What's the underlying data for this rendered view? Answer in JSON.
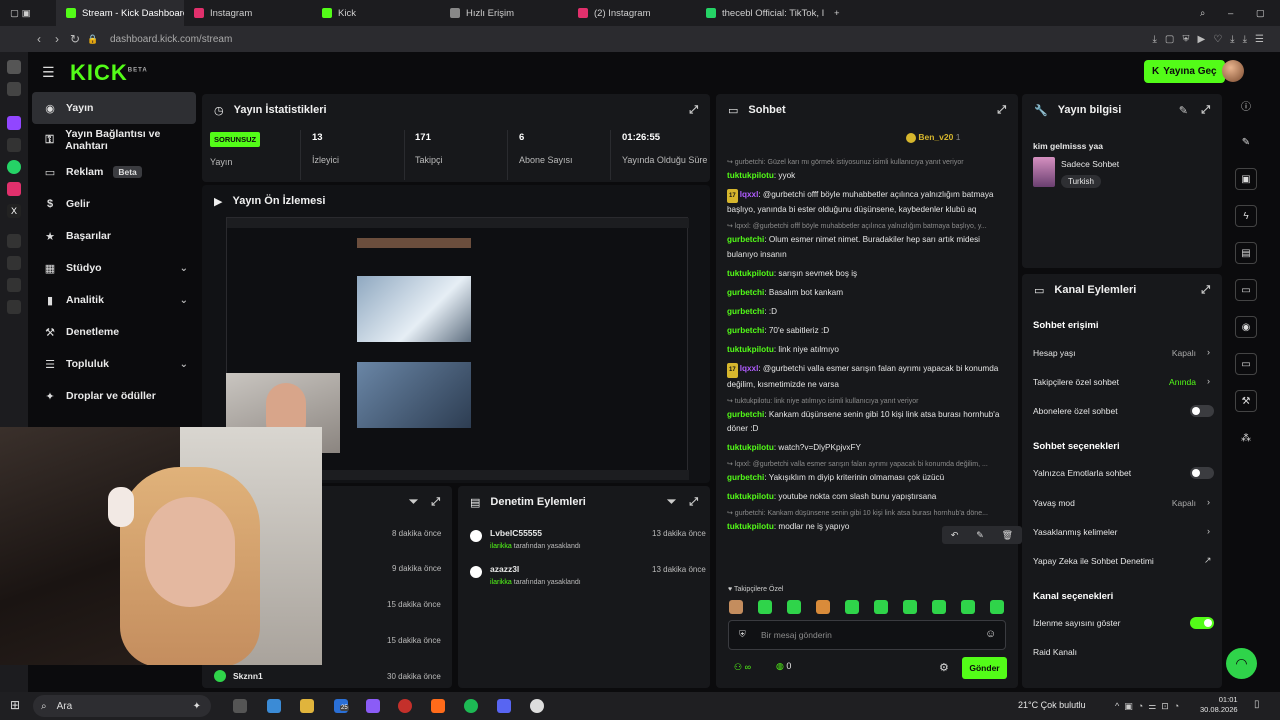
{
  "browser": {
    "tabs": [
      {
        "label": "Stream - Kick Dashboard",
        "color": "#53fc18"
      },
      {
        "label": "Instagram",
        "color": "#e1306c"
      },
      {
        "label": "Kick",
        "color": "#53fc18"
      },
      {
        "label": "Hızlı Erişim",
        "color": "#bbbbbb"
      },
      {
        "label": "(2) Instagram",
        "color": "#e1306c"
      },
      {
        "label": "thecebl Official: TikTok, Ins",
        "color": "#25d366"
      }
    ],
    "url": "dashboard.kick.com/stream"
  },
  "header": {
    "logo": "KICK",
    "logo_sup": "BETA",
    "go_live": "Yayına Geç"
  },
  "nav": [
    {
      "label": "Yayın",
      "icon": "◉"
    },
    {
      "label": "Yayın Bağlantısı ve Anahtarı",
      "icon": "⚿"
    },
    {
      "label": "Reklam",
      "icon": "▭",
      "badge": "Beta"
    },
    {
      "label": "Gelir",
      "icon": "$"
    },
    {
      "label": "Başarılar",
      "icon": "★"
    },
    {
      "label": "Stüdyo",
      "icon": "▦",
      "chevron": "⌄"
    },
    {
      "label": "Analitik",
      "icon": "▮",
      "chevron": "⌄"
    },
    {
      "label": "Denetleme",
      "icon": "⚒"
    },
    {
      "label": "Topluluk",
      "icon": "☰",
      "chevron": "⌄"
    },
    {
      "label": "Droplar ve ödüller",
      "icon": "✦"
    }
  ],
  "stats": {
    "title": "Yayın İstatistikleri",
    "status": "SORUNSUZ",
    "status_label": "Yayın",
    "items": [
      {
        "value": "13",
        "label": "İzleyici"
      },
      {
        "value": "171",
        "label": "Takipçi"
      },
      {
        "value": "6",
        "label": "Abone Sayısı"
      },
      {
        "value": "01:26:55",
        "label": "Yayında Olduğu Süre"
      }
    ]
  },
  "preview": {
    "title": "Yayın Ön İzlemesi"
  },
  "activity": {
    "times": [
      "8 dakika önce",
      "9 dakika önce",
      "15 dakika önce",
      "15 dakika önce",
      "30 dakika önce"
    ],
    "last_user": "Skznn1"
  },
  "mod": {
    "title": "Denetim Eylemleri",
    "rows": [
      {
        "user": "LvbelC55555",
        "by": "ilarikka",
        "action": "tarafından yasaklandı",
        "time": "13 dakika önce"
      },
      {
        "user": "azazz3l",
        "by": "ilarikka",
        "action": "tarafından yasaklandı",
        "time": "13 dakika önce"
      }
    ]
  },
  "chat": {
    "title": "Sohbet",
    "pinned_user": "Ben_v20",
    "pinned_count": "1",
    "lines": [
      {
        "type": "reply",
        "text": "↪ gurbetchi: Güzel karı mı görmek istiyosunuz isimli kullanıcıya yanıt veriyor"
      },
      {
        "type": "msg",
        "user": "tuktukpilotu",
        "color": "#53fc18",
        "text": "yyok"
      },
      {
        "type": "msg",
        "user": "lqxxl",
        "color": "#b05cff",
        "badge": "17",
        "text": "@gurbetchi offf böyle muhabbetler açılınca yalnızlığım batmaya başlıyo, yanında bi ester olduğunu düşünsene, kaybedenler klubü aq"
      },
      {
        "type": "reply",
        "text": "↪ lqxxl: @gurbetchi offf böyle muhabbetler açılınca yalnızlığım batmaya başlıyo, y..."
      },
      {
        "type": "msg",
        "user": "gurbetchi",
        "color": "#53fc18",
        "text": "Olum esmer nimet nimet. Buradakiler hep sarı artık midesi bulanıyo insanın"
      },
      {
        "type": "msg",
        "user": "tuktukpilotu",
        "color": "#53fc18",
        "text": "sarışın sevmek boş iş"
      },
      {
        "type": "msg",
        "user": "gurbetchi",
        "color": "#53fc18",
        "text": "Basalım bot kankam"
      },
      {
        "type": "msg",
        "user": "gurbetchi",
        "color": "#53fc18",
        "text": ":D"
      },
      {
        "type": "msg",
        "user": "gurbetchi",
        "color": "#53fc18",
        "text": "70'e sabitleriz :D"
      },
      {
        "type": "msg",
        "user": "tuktukpilotu",
        "color": "#53fc18",
        "text": "link niye atılmıyo"
      },
      {
        "type": "msg",
        "user": "lqxxl",
        "color": "#b05cff",
        "badge": "17",
        "text": "@gurbetchi valla esmer sarışın falan ayrımı yapacak bi konumda değilim, kısmetimizde ne varsa"
      },
      {
        "type": "reply",
        "text": "↪ tuktukpilotu: link niye atılmıyo isimli kullanıcıya yanıt veriyor"
      },
      {
        "type": "msg",
        "user": "gurbetchi",
        "color": "#53fc18",
        "text": "Kankam düşünsene senin gibi 10 kişi link atsa burası hornhub'a döner :D"
      },
      {
        "type": "msg",
        "user": "tuktukpilotu",
        "color": "#53fc18",
        "text": "watch?v=DlyPKpjvxFY"
      },
      {
        "type": "reply",
        "text": "↪ lqxxl: @gurbetchi valla esmer sarışın falan ayrımı yapacak bi konumda değilim, ..."
      },
      {
        "type": "msg",
        "user": "gurbetchi",
        "color": "#53fc18",
        "text": "Yakışıklım m diyip kriterinin olmaması çok üzücü"
      },
      {
        "type": "msg",
        "user": "tuktukpilotu",
        "color": "#53fc18",
        "text": "youtube nokta com slash bunu yapıştırsana"
      },
      {
        "type": "reply",
        "text": "↪ gurbetchi: Kankam düşünsene senin gibi 10 kişi link atsa burası hornhub'a döne..."
      },
      {
        "type": "msg",
        "user": "tuktukpilotu",
        "color": "#53fc18",
        "text": "modlar ne iş yapıyo"
      }
    ],
    "followers_only": "Takipçilere Özel",
    "input_placeholder": "Bir mesaj gönderin",
    "count": "0",
    "send": "Gönder"
  },
  "stream_info": {
    "title": "Yayın bilgisi",
    "stream_title": "kim gelmisss yaa",
    "category": "Sadece Sohbet",
    "tag": "Turkish"
  },
  "channel_actions": {
    "title": "Kanal Eylemleri",
    "sections": [
      {
        "heading": "Sohbet erişimi",
        "rows": [
          {
            "label": "Hesap yaşı",
            "value": "Kapalı",
            "type": "chevron"
          },
          {
            "label": "Takipçilere özel sohbet",
            "value": "Anında",
            "type": "chevron",
            "value_color": "#53fc18"
          },
          {
            "label": "Abonelere özel sohbet",
            "type": "toggle",
            "on": false
          }
        ]
      },
      {
        "heading": "Sohbet seçenekleri",
        "rows": [
          {
            "label": "Yalnızca Emotlarla sohbet",
            "type": "toggle",
            "on": false
          },
          {
            "label": "Yavaş mod",
            "value": "Kapalı",
            "type": "chevron"
          },
          {
            "label": "Yasaklanmış kelimeler",
            "type": "chevron"
          },
          {
            "label": "Yapay Zeka ile Sohbet Denetimi",
            "type": "external"
          }
        ]
      },
      {
        "heading": "Kanal seçenekleri",
        "rows": [
          {
            "label": "İzlenme sayısını göster",
            "type": "toggle",
            "on": true
          },
          {
            "label": "Raid Kanalı",
            "type": "none"
          }
        ]
      }
    ]
  },
  "taskbar": {
    "search": "Ara",
    "weather": "21°C  Çok bulutlu",
    "time": "01:01",
    "date": "30.08.2026",
    "badge": "25"
  },
  "colors": {
    "accent": "#53fc18",
    "panel": "#17181b",
    "bg": "#0b0b0d"
  }
}
